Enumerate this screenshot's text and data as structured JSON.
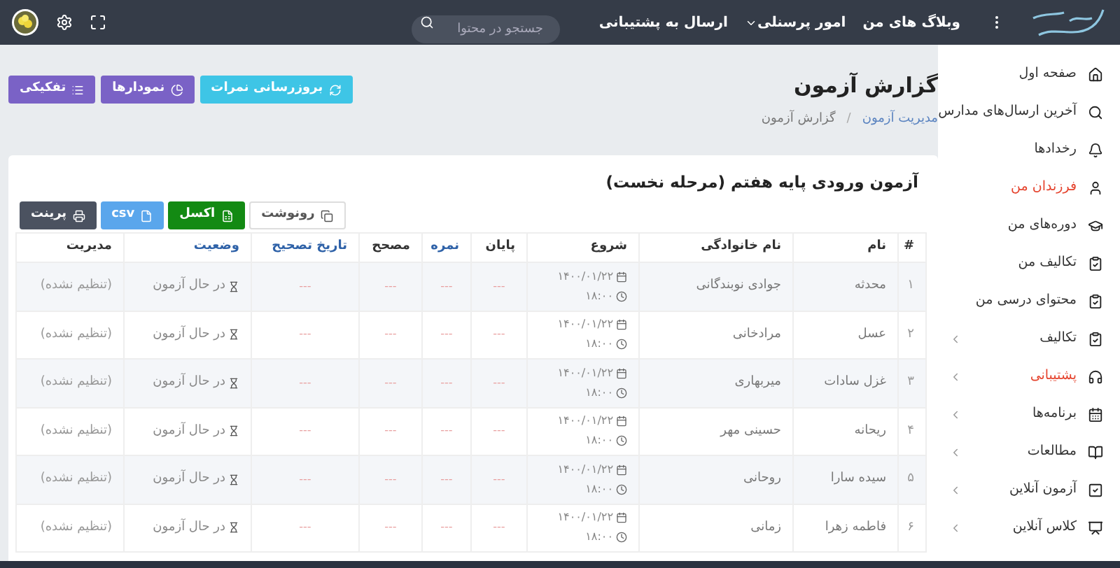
{
  "topbar": {
    "menu": [
      {
        "label": "وبلاگ های من",
        "dropdown": false
      },
      {
        "label": "امور پرسنلی",
        "dropdown": true
      },
      {
        "label": "ارسال به پشتیبانی",
        "dropdown": false
      }
    ],
    "search": {
      "placeholder": "جستجو در محتوا"
    }
  },
  "sidebar": {
    "items": [
      {
        "label": "صفحه اول",
        "active": false,
        "expandable": false
      },
      {
        "label": "آخرین ارسال‌های مدارس",
        "active": false,
        "expandable": false
      },
      {
        "label": "رخدادها",
        "active": false,
        "expandable": false
      },
      {
        "label": "فرزندان من",
        "active": true,
        "expandable": false
      },
      {
        "label": "دوره‌های من",
        "active": false,
        "expandable": false
      },
      {
        "label": "تکالیف من",
        "active": false,
        "expandable": false
      },
      {
        "label": "محتوای درسی من",
        "active": false,
        "expandable": false
      },
      {
        "label": "تکالیف",
        "active": false,
        "expandable": true
      },
      {
        "label": "پشتیبانی",
        "active": true,
        "expandable": true
      },
      {
        "label": "برنامه‌ها",
        "active": false,
        "expandable": true
      },
      {
        "label": "مطالعات",
        "active": false,
        "expandable": true
      },
      {
        "label": "آزمون آنلاین",
        "active": false,
        "expandable": true
      },
      {
        "label": "کلاس آنلاین",
        "active": false,
        "expandable": true
      }
    ]
  },
  "page": {
    "title": "گزارش آزمون",
    "breadcrumb_separator": "/",
    "breadcrumb": [
      {
        "label": "مدیریت آزمون",
        "link": true
      },
      {
        "label": "گزارش آزمون",
        "link": false
      }
    ],
    "actions": [
      {
        "label": "بروزرسانی نمرات",
        "kind": "refresh"
      },
      {
        "label": "نمودارها",
        "kind": "chart"
      },
      {
        "label": "تفکیکی",
        "kind": "list"
      }
    ]
  },
  "report": {
    "title": "آزمون ورودی پایه هفتم (مرحله نخست)",
    "exports": [
      {
        "label": "رونوشت",
        "kind": "copy"
      },
      {
        "label": "اکسل",
        "kind": "excel"
      },
      {
        "label": "csv",
        "kind": "csv"
      },
      {
        "label": "پرینت",
        "kind": "print"
      }
    ],
    "columns": [
      {
        "label": "#",
        "sortable": false
      },
      {
        "label": "نام",
        "sortable": false
      },
      {
        "label": "نام خانوادگی",
        "sortable": false
      },
      {
        "label": "شروع",
        "sortable": false
      },
      {
        "label": "پایان",
        "sortable": false
      },
      {
        "label": "نمره",
        "sortable": true
      },
      {
        "label": "مصحح",
        "sortable": false
      },
      {
        "label": "تاریخ تصحیح",
        "sortable": true
      },
      {
        "label": "وضعیت",
        "sortable": true
      },
      {
        "label": "مدیریت",
        "sortable": false
      }
    ],
    "rows": [
      {
        "index": "۱",
        "first_name": "محدثه",
        "last_name": "جوادی نوبندگانی",
        "start_date": "۱۴۰۰/۰۱/۲۲",
        "start_time": "۱۸:۰۰",
        "end": "---",
        "score": "---",
        "grader": "---",
        "graded_at": "---",
        "status": "در حال آزمون",
        "manage": "(تنظیم نشده)"
      },
      {
        "index": "۲",
        "first_name": "عسل",
        "last_name": "مرادخانی",
        "start_date": "۱۴۰۰/۰۱/۲۲",
        "start_time": "۱۸:۰۰",
        "end": "---",
        "score": "---",
        "grader": "---",
        "graded_at": "---",
        "status": "در حال آزمون",
        "manage": "(تنظیم نشده)"
      },
      {
        "index": "۳",
        "first_name": "غزل سادات",
        "last_name": "میربهاری",
        "start_date": "۱۴۰۰/۰۱/۲۲",
        "start_time": "۱۸:۰۰",
        "end": "---",
        "score": "---",
        "grader": "---",
        "graded_at": "---",
        "status": "در حال آزمون",
        "manage": "(تنظیم نشده)"
      },
      {
        "index": "۴",
        "first_name": "ریحانه",
        "last_name": "حسینی مهر",
        "start_date": "۱۴۰۰/۰۱/۲۲",
        "start_time": "۱۸:۰۰",
        "end": "---",
        "score": "---",
        "grader": "---",
        "graded_at": "---",
        "status": "در حال آزمون",
        "manage": "(تنظیم نشده)"
      },
      {
        "index": "۵",
        "first_name": "سیده سارا",
        "last_name": "روحانی",
        "start_date": "۱۴۰۰/۰۱/۲۲",
        "start_time": "۱۸:۰۰",
        "end": "---",
        "score": "---",
        "grader": "---",
        "graded_at": "---",
        "status": "در حال آزمون",
        "manage": "(تنظیم نشده)"
      },
      {
        "index": "۶",
        "first_name": "فاطمه زهرا",
        "last_name": "زمانی",
        "start_date": "۱۴۰۰/۰۱/۲۲",
        "start_time": "۱۸:۰۰",
        "end": "---",
        "score": "---",
        "grader": "---",
        "graded_at": "---",
        "status": "در حال آزمون",
        "manage": "(تنظیم نشده)"
      }
    ]
  }
}
